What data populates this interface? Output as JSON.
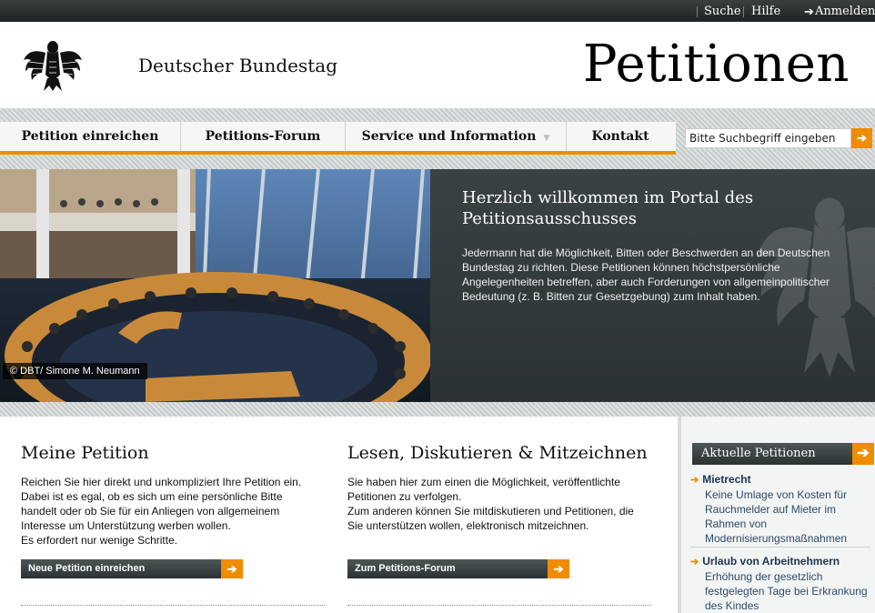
{
  "topbar": {
    "search": "Suche",
    "help": "Hilfe",
    "login": "Anmelden"
  },
  "header": {
    "institution": "Deutscher Bundestag",
    "portal_title": "Petitionen"
  },
  "nav": {
    "items": [
      {
        "label": "Petition einreichen"
      },
      {
        "label": "Petitions-Forum"
      },
      {
        "label": "Service und Information"
      },
      {
        "label": "Kontakt"
      }
    ],
    "search_placeholder": "Bitte Suchbegriff eingeben"
  },
  "hero": {
    "photo_credit": "© DBT/ Simone M. Neumann",
    "title_line1": "Herzlich willkommen im Portal des",
    "title_line2": "Petitionsausschusses",
    "text": "Jedermann hat die Möglichkeit, Bitten oder Beschwerden an den Deutschen Bundestag zu richten. Diese Petitionen können höchstpersönliche Angelegenheiten betreffen, aber auch Forderungen von allgemeinpolitischer Bedeutung (z. B. Bitten zur Gesetzgebung) zum Inhalt haben."
  },
  "col1": {
    "title": "Meine Petition",
    "text": "Reichen Sie hier direkt und unkompliziert Ihre Petition ein. Dabei ist es egal, ob es sich um eine persönliche Bitte handelt oder ob Sie für ein Anliegen von allgemeinem Interesse um Unterstützung werben wollen.",
    "text2": "Es erfordert nur wenige Schritte.",
    "button": "Neue Petition einreichen"
  },
  "col2": {
    "title": "Lesen, Diskutieren & Mitzeichnen",
    "text": "Sie haben hier zum einen die Möglichkeit, veröffentlichte Petitionen zu verfolgen.",
    "text2": "Zum anderen können Sie mitdiskutieren und Petitionen, die Sie unterstützen wollen, elektronisch mitzeichnen.",
    "button": "Zum Petitions-Forum"
  },
  "sidebar": {
    "heading": "Aktuelle Petitionen",
    "items": [
      {
        "title": "Mietrecht",
        "desc": "Keine Umlage von Kosten für Rauchmelder auf Mieter im Rahmen von Modernisierungsmaßnahmen"
      },
      {
        "title": "Urlaub von Arbeitnehmern",
        "desc": "Erhöhung der gesetzlich festgelegten Tage bei Erkrankung des Kindes"
      }
    ]
  },
  "colors": {
    "accent": "#f08c00",
    "dark_bar": "#2c3233",
    "link_blue": "#1a3550"
  }
}
